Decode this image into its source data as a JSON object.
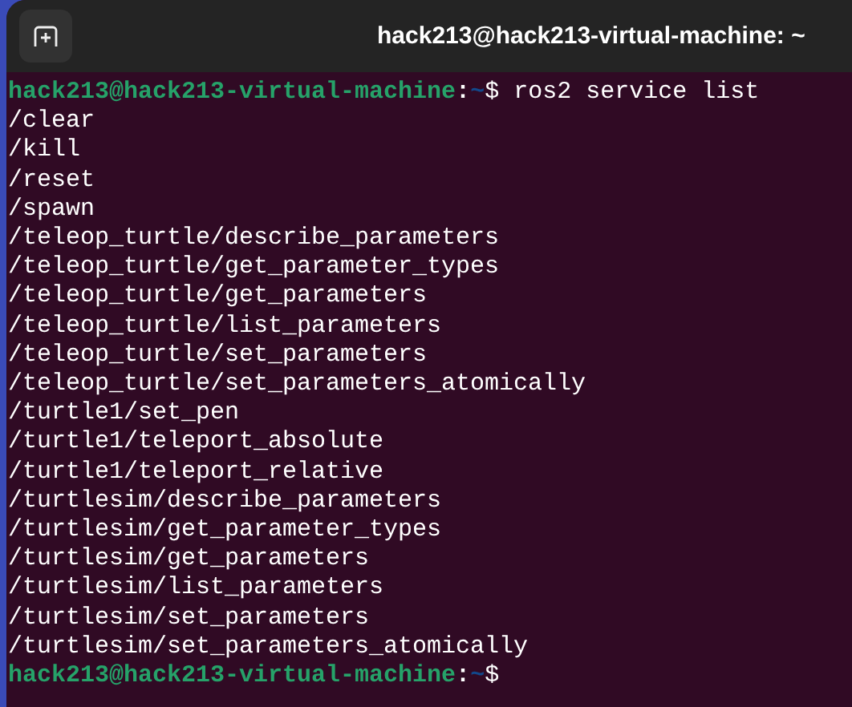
{
  "window": {
    "title": "hack213@hack213-virtual-machine: ~"
  },
  "lines": [
    {
      "kind": "prompt",
      "user_host": "hack213@hack213-virtual-machine",
      "separator": ":",
      "path": "~",
      "symbol": "$",
      "command": "ros2 service list"
    },
    {
      "kind": "output",
      "text": "/clear"
    },
    {
      "kind": "output",
      "text": "/kill"
    },
    {
      "kind": "output",
      "text": "/reset"
    },
    {
      "kind": "output",
      "text": "/spawn"
    },
    {
      "kind": "output",
      "text": "/teleop_turtle/describe_parameters"
    },
    {
      "kind": "output",
      "text": "/teleop_turtle/get_parameter_types"
    },
    {
      "kind": "output",
      "text": "/teleop_turtle/get_parameters"
    },
    {
      "kind": "output",
      "text": "/teleop_turtle/list_parameters"
    },
    {
      "kind": "output",
      "text": "/teleop_turtle/set_parameters"
    },
    {
      "kind": "output",
      "text": "/teleop_turtle/set_parameters_atomically"
    },
    {
      "kind": "output",
      "text": "/turtle1/set_pen"
    },
    {
      "kind": "output",
      "text": "/turtle1/teleport_absolute"
    },
    {
      "kind": "output",
      "text": "/turtle1/teleport_relative"
    },
    {
      "kind": "output",
      "text": "/turtlesim/describe_parameters"
    },
    {
      "kind": "output",
      "text": "/turtlesim/get_parameter_types"
    },
    {
      "kind": "output",
      "text": "/turtlesim/get_parameters"
    },
    {
      "kind": "output",
      "text": "/turtlesim/list_parameters"
    },
    {
      "kind": "output",
      "text": "/turtlesim/set_parameters"
    },
    {
      "kind": "output",
      "text": "/turtlesim/set_parameters_atomically"
    },
    {
      "kind": "prompt",
      "user_host": "hack213@hack213-virtual-machine",
      "separator": ":",
      "path": "~",
      "symbol": "$"
    }
  ]
}
